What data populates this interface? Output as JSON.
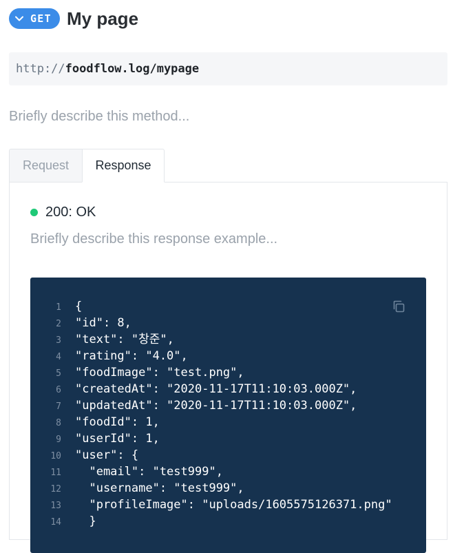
{
  "header": {
    "method": "GET",
    "title": "My page"
  },
  "url": {
    "protocol": "http://",
    "path": "foodflow.log/mypage"
  },
  "method_description_placeholder": "Briefly describe this method...",
  "tabs": [
    {
      "label": "Request",
      "active": false
    },
    {
      "label": "Response",
      "active": true
    }
  ],
  "response": {
    "status": "200: OK",
    "status_color": "#1fc977",
    "description_placeholder": "Briefly describe this response example...",
    "code_lines": [
      {
        "num": "1",
        "text": "{"
      },
      {
        "num": "2",
        "text": "\"id\": 8,"
      },
      {
        "num": "3",
        "text": "\"text\": \"창준\","
      },
      {
        "num": "4",
        "text": "\"rating\": \"4.0\","
      },
      {
        "num": "5",
        "text": "\"foodImage\": \"test.png\","
      },
      {
        "num": "6",
        "text": "\"createdAt\": \"2020-11-17T11:10:03.000Z\","
      },
      {
        "num": "7",
        "text": "\"updatedAt\": \"2020-11-17T11:10:03.000Z\","
      },
      {
        "num": "8",
        "text": "\"foodId\": 1,"
      },
      {
        "num": "9",
        "text": "\"userId\": 1,"
      },
      {
        "num": "10",
        "text": "\"user\": {"
      },
      {
        "num": "11",
        "text": "  \"email\": \"test999\","
      },
      {
        "num": "12",
        "text": "  \"username\": \"test999\","
      },
      {
        "num": "13",
        "text": "  \"profileImage\": \"uploads/1605575126371.png\""
      },
      {
        "num": "14",
        "text": "  }"
      }
    ]
  },
  "colors": {
    "method_badge": "#3b8ce8",
    "code_background": "#16324f"
  },
  "icons": {
    "method_toggle": "chevron-down-icon",
    "copy": "copy-icon"
  }
}
